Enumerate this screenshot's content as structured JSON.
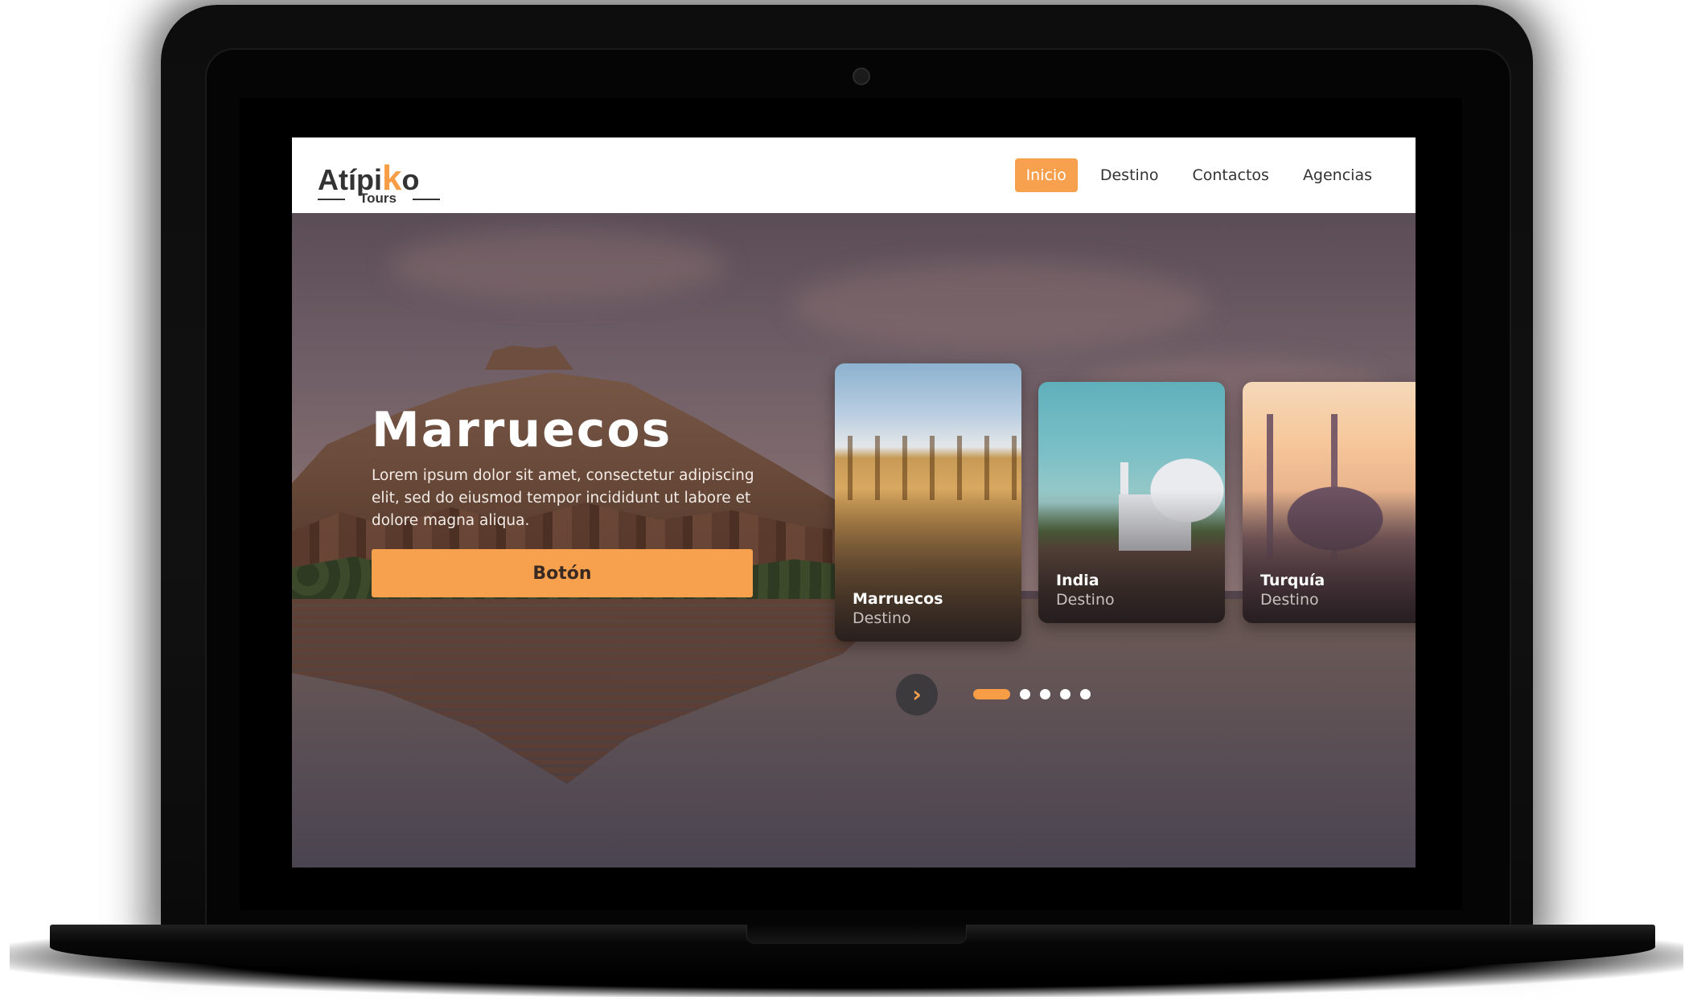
{
  "logo": {
    "main_prefix": "Atípi",
    "main_highlight": "k",
    "main_suffix": "o",
    "sub": "Tours"
  },
  "nav": {
    "items": [
      {
        "label": "Inicio",
        "active": true
      },
      {
        "label": "Destino",
        "active": false
      },
      {
        "label": "Contactos",
        "active": false
      },
      {
        "label": "Agencias",
        "active": false
      }
    ]
  },
  "hero": {
    "title": "Marruecos",
    "description": "Lorem ipsum dolor sit amet, consectetur adipiscing elit, sed do eiusmod tempor incididunt ut labore et dolore magna aliqua.",
    "button_label": "Botón"
  },
  "cards": [
    {
      "name": "Marruecos",
      "subtitle": "Destino"
    },
    {
      "name": "India",
      "subtitle": "Destino"
    },
    {
      "name": "Turquía",
      "subtitle": "Destino"
    }
  ],
  "slider": {
    "next_icon": "chevron-right-icon",
    "page_count": 5,
    "active_index": 0
  },
  "colors": {
    "accent": "#f79d46",
    "text_dark": "#333333",
    "white": "#ffffff"
  }
}
